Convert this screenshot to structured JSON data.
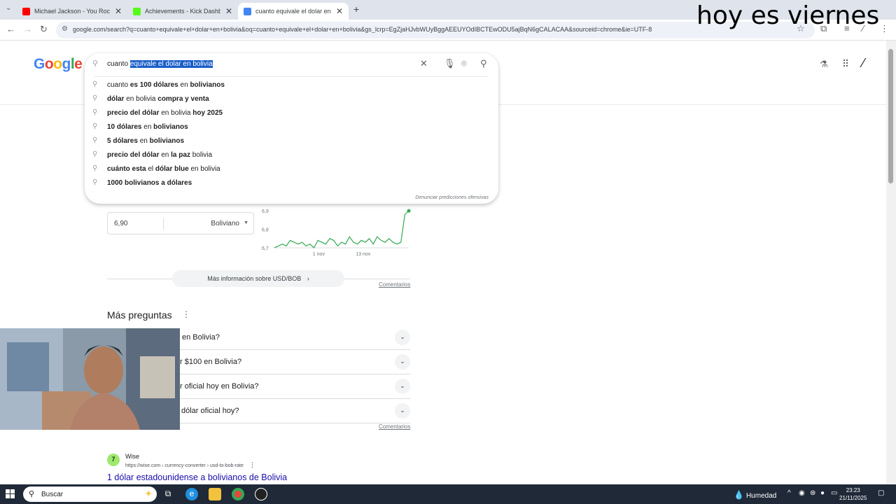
{
  "browser": {
    "tabs": [
      {
        "title": "Michael Jackson - You Rock My",
        "favicon_color": "#ff0000",
        "active": false
      },
      {
        "title": "Achievements - Kick Dashboard",
        "favicon_color": "#53fc18",
        "active": false
      },
      {
        "title": "cuanto equivale el dolar en boli",
        "favicon_color": "#4285f4",
        "active": true
      }
    ],
    "new_tab_label": "+",
    "url": "google.com/search?q=cuanto+equivale+el+dolar+en+bolivia&oq=cuanto+equivale+el+dolar+en+bolivia&gs_lcrp=EgZjaHJvbWUyBggAEEUYOdIBCTEwODU5ajBqN6gCALACAA&sourceid=chrome&ie=UTF-8"
  },
  "overlay_text": "hoy es viernes",
  "google": {
    "logo": [
      "G",
      "o",
      "o",
      "g",
      "l",
      "e"
    ],
    "logo_colors": [
      "#4285f4",
      "#ea4335",
      "#fbbc05",
      "#4285f4",
      "#34a853",
      "#ea4335"
    ],
    "query_typed": "cuanto",
    "query_selected": "equivale el dolar en bolivia",
    "suggestions": [
      [
        {
          "t": "cuanto ",
          "b": false
        },
        {
          "t": "es 100 dólares",
          "b": true
        },
        {
          "t": " en ",
          "b": false
        },
        {
          "t": "bolivianos",
          "b": true
        }
      ],
      [
        {
          "t": "dólar",
          "b": true
        },
        {
          "t": " en bolivia ",
          "b": false
        },
        {
          "t": "compra y venta",
          "b": true
        }
      ],
      [
        {
          "t": "precio del dólar",
          "b": true
        },
        {
          "t": " en bolivia ",
          "b": false
        },
        {
          "t": "hoy 2025",
          "b": true
        }
      ],
      [
        {
          "t": "10 dólares",
          "b": true
        },
        {
          "t": " en ",
          "b": false
        },
        {
          "t": "bolivianos",
          "b": true
        }
      ],
      [
        {
          "t": "5 dólares",
          "b": true
        },
        {
          "t": " en ",
          "b": false
        },
        {
          "t": "bolivianos",
          "b": true
        }
      ],
      [
        {
          "t": "precio del dólar",
          "b": true
        },
        {
          "t": " en ",
          "b": false
        },
        {
          "t": "la paz",
          "b": true
        },
        {
          "t": " bolivia",
          "b": false
        }
      ],
      [
        {
          "t": "cuánto esta",
          "b": true
        },
        {
          "t": " el ",
          "b": false
        },
        {
          "t": "dólar blue",
          "b": true
        },
        {
          "t": " en bolivia",
          "b": false
        }
      ],
      [
        {
          "t": "1000 bolivianos a dólares",
          "b": true
        }
      ]
    ],
    "report_label": "Denunciar predicciones ofensivas"
  },
  "converter": {
    "value": "6,90",
    "currency": "Boliviano"
  },
  "chart_data": {
    "type": "line",
    "y_ticks": [
      "6,9",
      "6,8",
      "6,7"
    ],
    "ylim": [
      6.7,
      6.95
    ],
    "x_ticks": [
      "1 nov",
      "13 nov"
    ],
    "series": [
      {
        "values": [
          6.7,
          6.71,
          6.72,
          6.71,
          6.74,
          6.73,
          6.72,
          6.73,
          6.71,
          6.72,
          6.7,
          6.74,
          6.73,
          6.72,
          6.75,
          6.74,
          6.71,
          6.73,
          6.72,
          6.76,
          6.73,
          6.72,
          6.74,
          6.73,
          6.75,
          6.72,
          6.76,
          6.74,
          6.73,
          6.75,
          6.73,
          6.72,
          6.73,
          6.88,
          6.9
        ]
      }
    ],
    "line_color": "#34a853"
  },
  "more_info_label": "Más información sobre USD/BOB",
  "comments_label": "Comentarios",
  "faq": {
    "title": "Más preguntas",
    "items": [
      "en Bolivia?",
      "r $100 en Bolivia?",
      "r oficial hoy en Bolivia?",
      "dólar oficial hoy?"
    ]
  },
  "result": {
    "site": "Wise",
    "favicon_text": "7",
    "url": "https://wise.com › currency-converter › usd-to-bob-rate",
    "title": "1 dólar estadounidense a bolivianos de Bolivia"
  },
  "taskbar": {
    "search_placeholder": "Buscar",
    "weather": "Humedad",
    "time": "23:23",
    "date": "21/11/2025"
  }
}
